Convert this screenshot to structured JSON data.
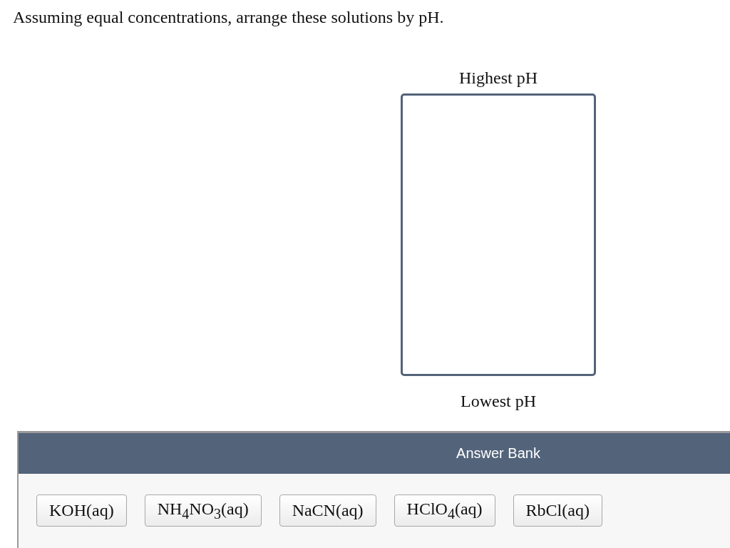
{
  "question": "Assuming equal concentrations, arrange these solutions by pH.",
  "ranking": {
    "top_label": "Highest pH",
    "bottom_label": "Lowest pH"
  },
  "answer_bank": {
    "title": "Answer Bank",
    "items": [
      "KOH(aq)",
      "NH$_{4}$NO$_{3}$(aq)",
      "NaCN(aq)",
      "HClO$_{4}$(aq)",
      "RbCl(aq)"
    ]
  }
}
